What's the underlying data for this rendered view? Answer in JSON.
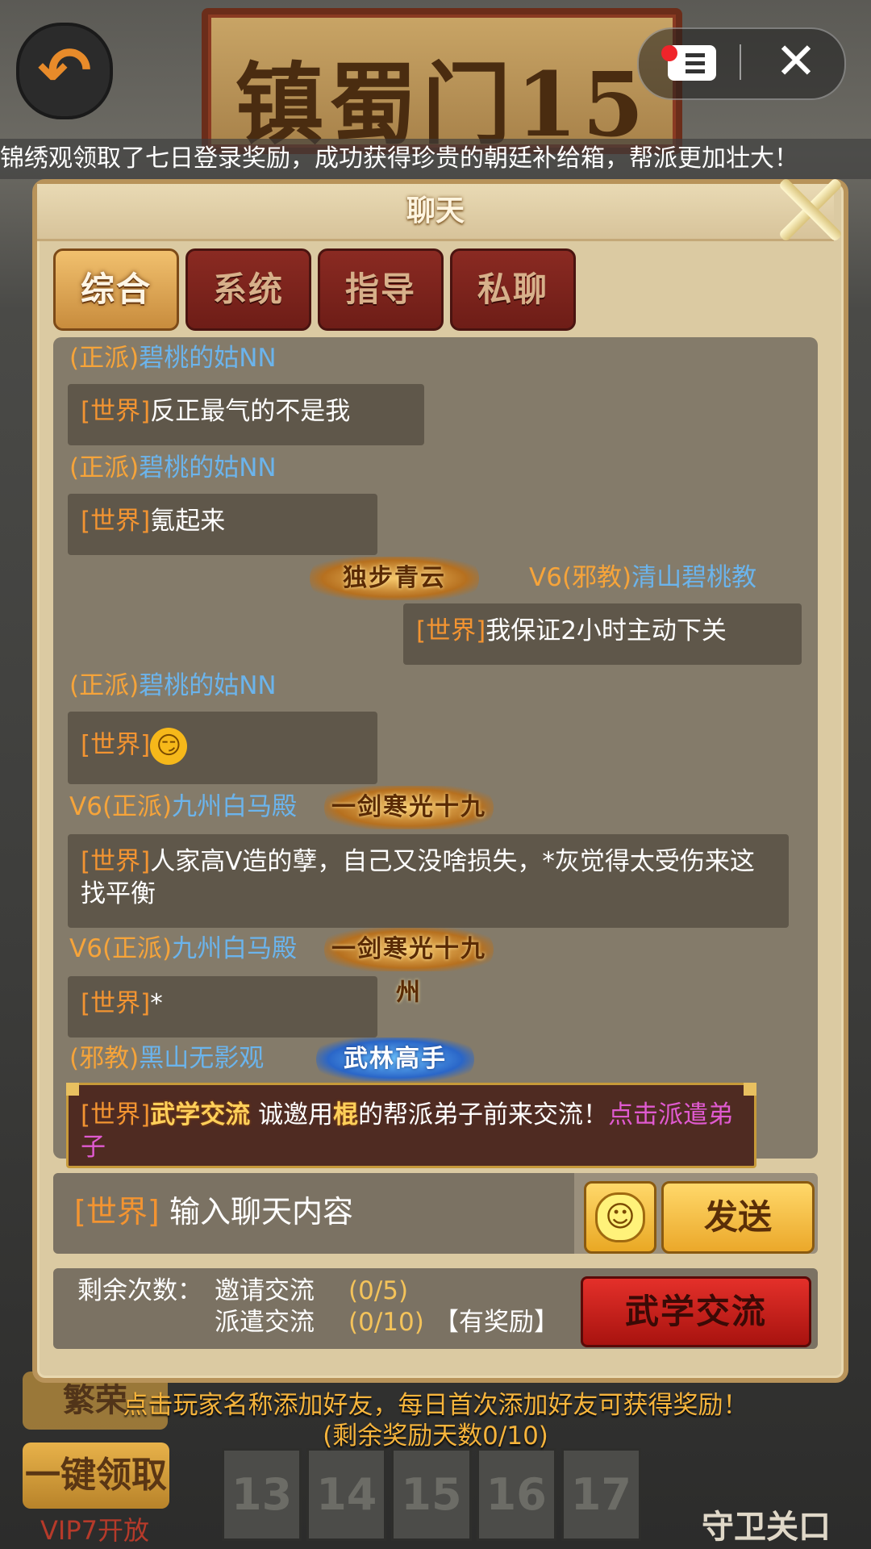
{
  "header": {
    "banner_title": "镇蜀门15",
    "back_icon": "back-arrow-icon",
    "menu_icon": "menu-icon",
    "close_icon": "close-icon"
  },
  "marquee": "锦绣观领取了七日登录奖励，成功获得珍贵的朝廷补给箱，帮派更加壮大！",
  "panel": {
    "title": "聊天",
    "tabs": [
      {
        "label": "综合",
        "active": true
      },
      {
        "label": "系统",
        "active": false
      },
      {
        "label": "指导",
        "active": false
      },
      {
        "label": "私聊",
        "active": false
      }
    ]
  },
  "messages": [
    {
      "faction": "(正派)",
      "name": "碧桃的姑NN",
      "channel": "[世界]",
      "text": "反正最气的不是我"
    },
    {
      "faction": "(正派)",
      "name": "碧桃的姑NN",
      "channel": "[世界]",
      "text": "氪起来"
    },
    {
      "vip": "V6",
      "faction": "(邪教)",
      "name": "清山碧桃教",
      "title": "独步青云",
      "channel": "[世界]",
      "text": "我保证2小时主动下关"
    },
    {
      "faction": "(正派)",
      "name": "碧桃的姑NN",
      "channel": "[世界]",
      "text": "😏"
    },
    {
      "vip": "V6",
      "faction": "(正派)",
      "name": "九州白马殿",
      "title": "一剑寒光十九州",
      "channel": "[世界]",
      "text": "人家高V造的孽，自己又没啥损失，*灰觉得太受伤来这找平衡"
    },
    {
      "vip": "V6",
      "faction": "(正派)",
      "name": "九州白马殿",
      "title": "一剑寒光十九州",
      "channel": "[世界]",
      "text": "*"
    },
    {
      "faction": "(邪教)",
      "name": "黑山无影观",
      "title": "武林高手"
    }
  ],
  "invite_card": {
    "channel": "[世界]",
    "event": "武学交流",
    "text_before": "诚邀用",
    "weapon": "棍",
    "text_after": "的帮派弟子前来交流！",
    "link": "点击派遣弟子"
  },
  "input": {
    "channel": "[世界]",
    "placeholder": "输入聊天内容",
    "emoji_icon": "smiley-icon",
    "send_label": "发送"
  },
  "counts": {
    "label": "剩余次数：",
    "invite_label": "邀请交流",
    "invite_value": "(0/5)",
    "dispatch_label": "派遣交流",
    "dispatch_value": "(0/10)",
    "reward_tag": "【有奖励】",
    "button_label": "武学交流"
  },
  "hints": {
    "line1": "点击玩家名称添加好友，每日首次添加好友可获得奖励！",
    "line2": "(剩余奖励天数0/10)"
  },
  "background": {
    "fanrong_label": "繁荣",
    "claim_all_label": "一键领取",
    "vip_label": "VIP7开放",
    "levels": [
      "13",
      "14",
      "15",
      "16",
      "17"
    ],
    "guard_label": "守卫关口"
  }
}
